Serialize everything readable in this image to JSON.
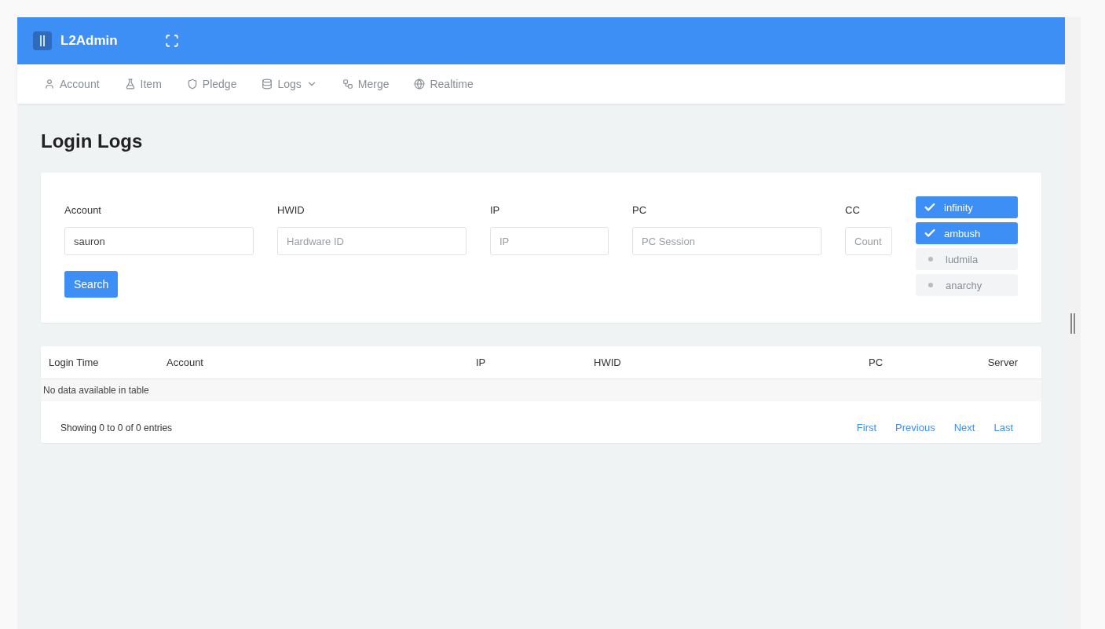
{
  "header": {
    "brand": "L2Admin"
  },
  "nav": [
    {
      "kind": "user",
      "label": "Account",
      "dropdown": false
    },
    {
      "kind": "flask",
      "label": "Item",
      "dropdown": false
    },
    {
      "kind": "shield",
      "label": "Pledge",
      "dropdown": false
    },
    {
      "kind": "database",
      "label": "Logs",
      "dropdown": true
    },
    {
      "kind": "merge",
      "label": "Merge",
      "dropdown": false
    },
    {
      "kind": "globe",
      "label": "Realtime",
      "dropdown": false
    }
  ],
  "page_title": "Login Logs",
  "filters": [
    {
      "label": "Account",
      "value": "sauron"
    },
    {
      "label": "HWID",
      "placeholder": "Hardware ID"
    },
    {
      "label": "IP",
      "placeholder": "IP"
    },
    {
      "label": "PC",
      "placeholder": "PC Session"
    },
    {
      "label": "CC",
      "placeholder": "Count"
    }
  ],
  "search_button": "Search",
  "servers": [
    {
      "name": "infinity",
      "checked": true
    },
    {
      "name": "ambush",
      "checked": true
    },
    {
      "name": "ludmila",
      "checked": false
    },
    {
      "name": "anarchy",
      "checked": false
    }
  ],
  "table": {
    "columns": [
      "Login Time",
      "Account",
      "IP",
      "HWID",
      "PC",
      "Server"
    ],
    "empty_message": "No data available in table",
    "info": "Showing 0 to 0 of 0 entries",
    "pagination": [
      "First",
      "Previous",
      "Next",
      "Last"
    ]
  }
}
